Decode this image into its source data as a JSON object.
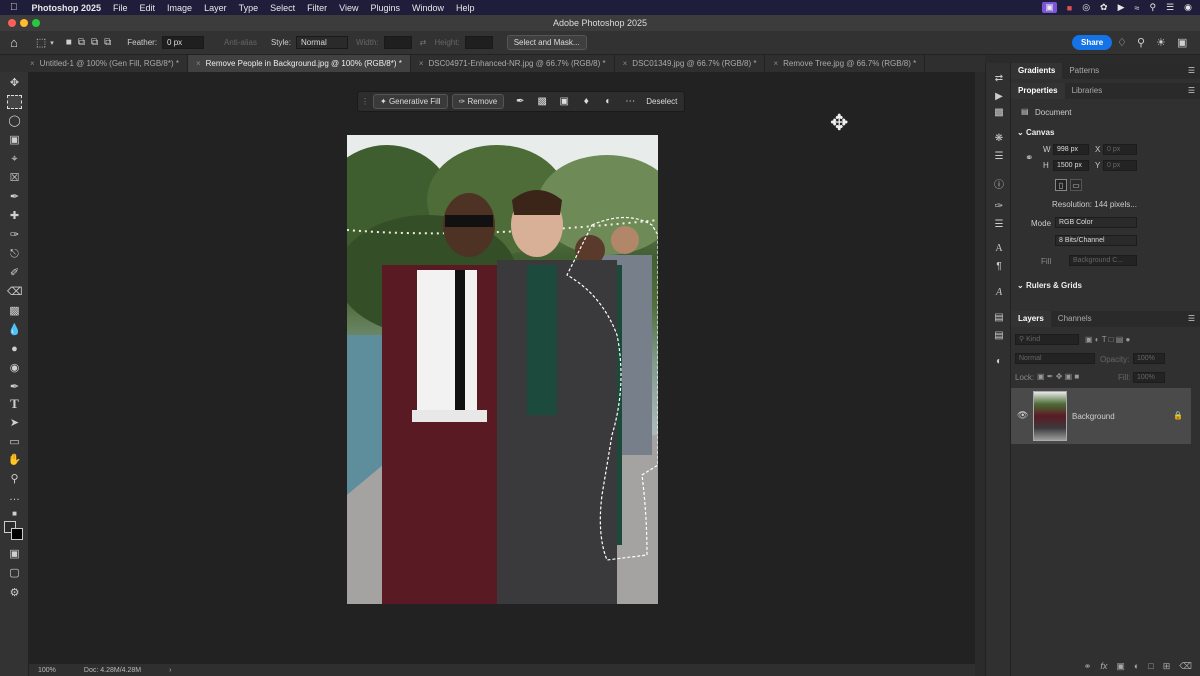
{
  "menubar": {
    "app_name": "Photoshop 2025",
    "items": [
      "File",
      "Edit",
      "Image",
      "Layer",
      "Type",
      "Select",
      "Filter",
      "View",
      "Plugins",
      "Window",
      "Help"
    ]
  },
  "window": {
    "title": "Adobe Photoshop 2025"
  },
  "options_bar": {
    "feather_label": "Feather:",
    "feather_value": "0 px",
    "antialias_label": "Anti-alias",
    "style_label": "Style:",
    "style_value": "Normal",
    "width_label": "Width:",
    "height_label": "Height:",
    "select_mask_label": "Select and Mask...",
    "share_label": "Share"
  },
  "doc_tabs": [
    {
      "label": "Untitled-1 @ 100% (Gen Fill, RGB/8*) *",
      "active": false
    },
    {
      "label": "Remove People in Background.jpg @ 100% (RGB/8*) *",
      "active": true
    },
    {
      "label": "DSC04971-Enhanced-NR.jpg @ 66.7% (RGB/8) *",
      "active": false
    },
    {
      "label": "DSC01349.jpg @ 66.7% (RGB/8) *",
      "active": false
    },
    {
      "label": "Remove Tree.jpg @ 66.7% (RGB/8) *",
      "active": false
    }
  ],
  "context_bar": {
    "generative_fill_label": "Generative Fill",
    "remove_label": "Remove",
    "deselect_label": "Deselect"
  },
  "status_bar": {
    "zoom": "100%",
    "doc": "Doc: 4.28M/4.28M"
  },
  "right_panels": {
    "top_tabs": [
      "Gradients",
      "Patterns"
    ],
    "prop_tabs": [
      "Properties",
      "Libraries"
    ],
    "document_label": "Document",
    "canvas_header": "Canvas",
    "w_label": "W",
    "w_value": "998 px",
    "h_label": "H",
    "h_value": "1500 px",
    "x_label": "X",
    "x_value": "0 px",
    "y_label": "Y",
    "y_value": "0 px",
    "resolution": "Resolution: 144 pixels...",
    "mode_label": "Mode",
    "mode_value": "RGB Color",
    "bits_value": "8 Bits/Channel",
    "fill_label": "Fill",
    "fill_value": "Background C...",
    "rulers_header": "Rulers & Grids",
    "layer_tabs": [
      "Layers",
      "Channels"
    ],
    "kind_placeholder": "Kind",
    "blend_mode": "Normal",
    "opacity_label": "Opacity:",
    "opacity_value": "100%",
    "lock_label": "Lock:",
    "fill_label_layers": "Fill:",
    "fill_value_layers": "100%",
    "layer_name": "Background"
  },
  "colors": {
    "accent": "#1473e6",
    "panel_bg": "#303030",
    "canvas_bg": "#222222"
  }
}
